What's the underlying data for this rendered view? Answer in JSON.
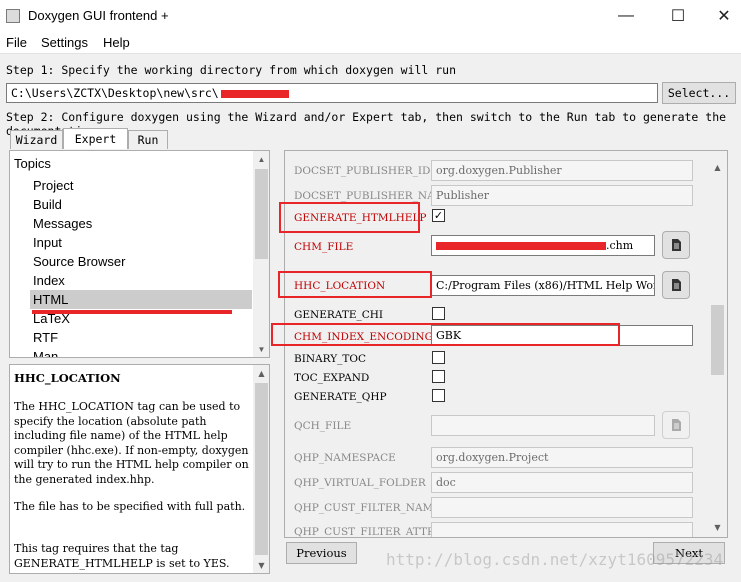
{
  "window": {
    "title": "Doxygen GUI frontend +",
    "minimize": "—",
    "maximize": "☐",
    "close": "✕"
  },
  "menu": [
    "File",
    "Settings",
    "Help"
  ],
  "step1": {
    "label": "Step 1: Specify the working directory from which doxygen will run",
    "path": "C:\\Users\\ZCTX\\Desktop\\new\\src\\",
    "select_button": "Select..."
  },
  "step2": {
    "label": "Step 2: Configure doxygen using the Wizard and/or Expert tab, then switch to the Run tab to generate the documentation"
  },
  "tabs": [
    "Wizard",
    "Expert",
    "Run"
  ],
  "topics": {
    "header": "Topics",
    "items": [
      "Project",
      "Build",
      "Messages",
      "Input",
      "Source Browser",
      "Index",
      "HTML",
      "LaTeX",
      "RTF",
      "Man"
    ],
    "selected": "HTML"
  },
  "help": {
    "title": "HHC_LOCATION",
    "para1": "The HHC_LOCATION tag can be used to specify the location (absolute path including file name) of the HTML help compiler (hhc.exe). If non-empty, doxygen will try to run the HTML help compiler on the generated index.hhp.",
    "para2": "The file has to be specified with full path.",
    "para3": "This tag requires that the tag GENERATE_HTMLHELP is set to YES."
  },
  "options": {
    "docset_publisher_id": {
      "label": "DOCSET_PUBLISHER_ID",
      "value": "org.doxygen.Publisher"
    },
    "docset_publisher_name": {
      "label": "DOCSET_PUBLISHER_NAME",
      "value": "Publisher"
    },
    "generate_htmlhelp": {
      "label": "GENERATE_HTMLHELP",
      "checked": "✓"
    },
    "chm_file": {
      "label": "CHM_FILE",
      "value": ".chm"
    },
    "hhc_location": {
      "label": "HHC_LOCATION",
      "value": "C:/Program Files (x86)/HTML Help Work"
    },
    "generate_chi": {
      "label": "GENERATE_CHI"
    },
    "chm_index_encoding": {
      "label": "CHM_INDEX_ENCODING",
      "value": "GBK"
    },
    "binary_toc": {
      "label": "BINARY_TOC"
    },
    "toc_expand": {
      "label": "TOC_EXPAND"
    },
    "generate_qhp": {
      "label": "GENERATE_QHP"
    },
    "qch_file": {
      "label": "QCH_FILE",
      "value": ""
    },
    "qhp_namespace": {
      "label": "QHP_NAMESPACE",
      "value": "org.doxygen.Project"
    },
    "qhp_virtual_folder": {
      "label": "QHP_VIRTUAL_FOLDER",
      "value": "doc"
    },
    "qhp_cust_filter_name": {
      "label": "QHP_CUST_FILTER_NAME",
      "value": ""
    },
    "qhp_cust_filter_attrs": {
      "label": "QHP_CUST_FILTER_ATTRS",
      "value": ""
    }
  },
  "nav": {
    "previous": "Previous",
    "next": "Next"
  },
  "watermark": "http://blog.csdn.net/xzyt1609572234",
  "annotation_color": "#e8262a"
}
